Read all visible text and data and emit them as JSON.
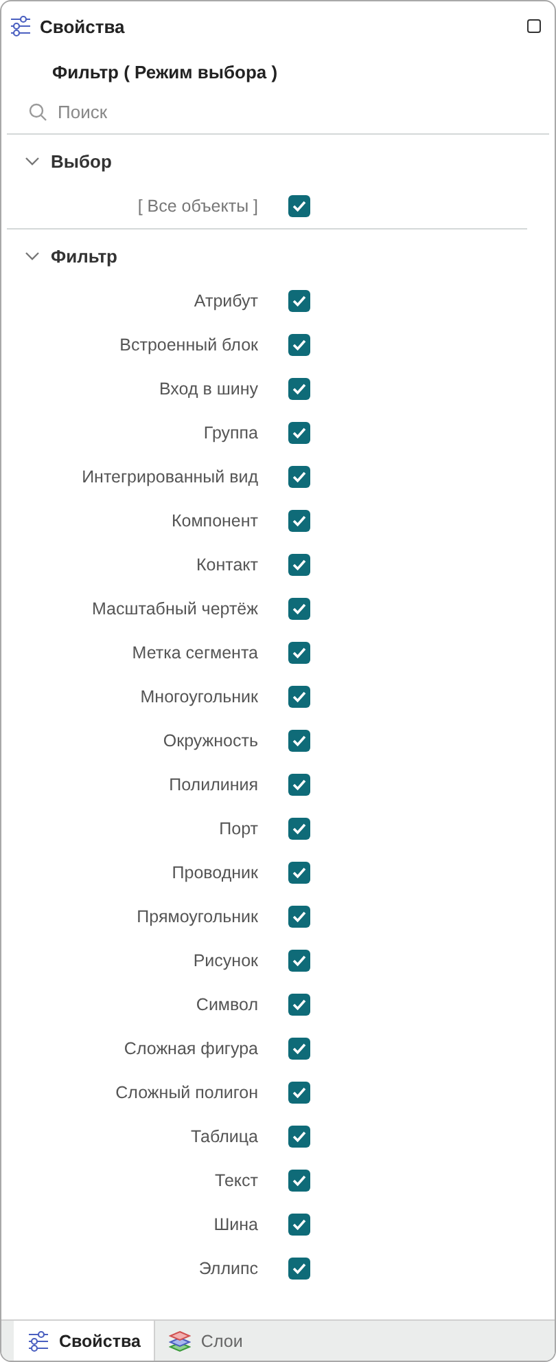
{
  "header": {
    "title": "Свойства",
    "maximized": false
  },
  "subtitle": "Фильтр ( Режим выбора )",
  "search": {
    "placeholder": "Поиск"
  },
  "sections": [
    {
      "title": "Выбор",
      "expanded": true,
      "items": [
        {
          "label": "[ Все объекты ]",
          "kind": "bracket",
          "checked": true
        }
      ]
    },
    {
      "title": "Фильтр",
      "expanded": true,
      "items": [
        {
          "label": "Атрибут",
          "kind": "plain",
          "checked": true
        },
        {
          "label": "Встроенный блок",
          "kind": "plain",
          "checked": true
        },
        {
          "label": "Вход в шину",
          "kind": "plain",
          "checked": true
        },
        {
          "label": "Группа",
          "kind": "plain",
          "checked": true
        },
        {
          "label": "Интегрированный вид",
          "kind": "plain",
          "checked": true
        },
        {
          "label": "Компонент",
          "kind": "plain",
          "checked": true
        },
        {
          "label": "Контакт",
          "kind": "plain",
          "checked": true
        },
        {
          "label": "Масштабный чертёж",
          "kind": "plain",
          "checked": true
        },
        {
          "label": "Метка сегмента",
          "kind": "plain",
          "checked": true
        },
        {
          "label": "Многоугольник",
          "kind": "plain",
          "checked": true
        },
        {
          "label": "Окружность",
          "kind": "plain",
          "checked": true
        },
        {
          "label": "Полилиния",
          "kind": "plain",
          "checked": true
        },
        {
          "label": "Порт",
          "kind": "plain",
          "checked": true
        },
        {
          "label": "Проводник",
          "kind": "plain",
          "checked": true
        },
        {
          "label": "Прямоугольник",
          "kind": "plain",
          "checked": true
        },
        {
          "label": "Рисунок",
          "kind": "plain",
          "checked": true
        },
        {
          "label": "Символ",
          "kind": "plain",
          "checked": true
        },
        {
          "label": "Сложная фигура",
          "kind": "plain",
          "checked": true
        },
        {
          "label": "Сложный полигон",
          "kind": "plain",
          "checked": true
        },
        {
          "label": "Таблица",
          "kind": "plain",
          "checked": true
        },
        {
          "label": "Текст",
          "kind": "plain",
          "checked": true
        },
        {
          "label": "Шина",
          "kind": "plain",
          "checked": true
        },
        {
          "label": "Эллипс",
          "kind": "plain",
          "checked": true
        }
      ]
    }
  ],
  "tabs": [
    {
      "label": "Свойства",
      "selected": true
    },
    {
      "label": "Слои",
      "selected": false
    }
  ]
}
